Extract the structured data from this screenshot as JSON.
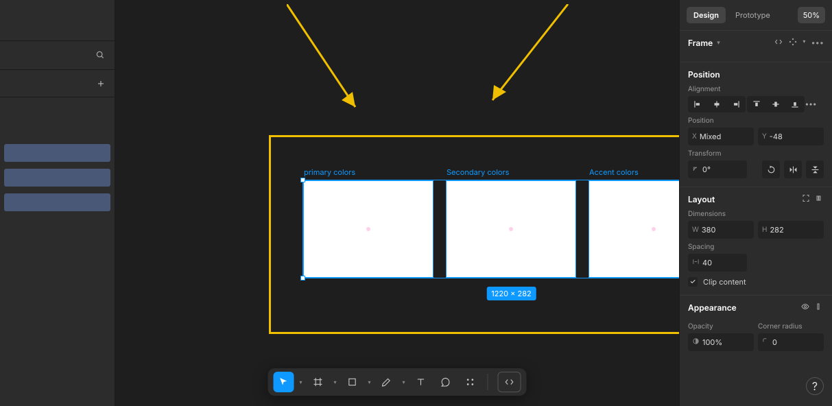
{
  "tabs": {
    "design": "Design",
    "prototype": "Prototype",
    "zoom": "50%"
  },
  "frame_section": {
    "title": "Frame"
  },
  "position_section": {
    "title": "Position",
    "alignment_label": "Alignment",
    "position_label": "Position",
    "x_prefix": "X",
    "x_value": "Mixed",
    "y_prefix": "Y",
    "y_value": "-48",
    "transform_label": "Transform",
    "rotation": "0°"
  },
  "layout_section": {
    "title": "Layout",
    "dimensions_label": "Dimensions",
    "w_prefix": "W",
    "w_value": "380",
    "h_prefix": "H",
    "h_value": "282",
    "spacing_label": "Spacing",
    "spacing_value": "40",
    "clip_content": "Clip content"
  },
  "appearance_section": {
    "title": "Appearance",
    "opacity_label": "Opacity",
    "opacity_value": "100%",
    "corner_label": "Corner radius",
    "corner_value": "0"
  },
  "canvas": {
    "frames": [
      {
        "label": "primary colors"
      },
      {
        "label": "Secondary colors"
      },
      {
        "label": "Accent colors"
      }
    ],
    "selection_size": "1220 × 282"
  },
  "help": "?"
}
